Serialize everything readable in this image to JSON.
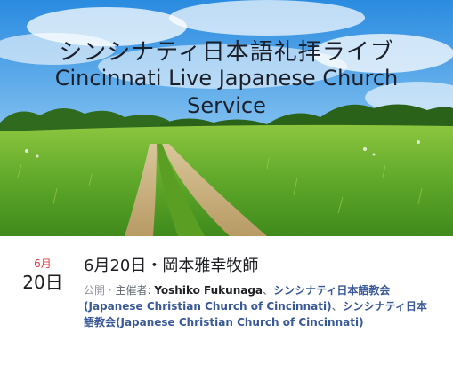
{
  "cover": {
    "title_jp": "シンシナティ日本語礼拝ライブ",
    "title_en_line1": "Cincinnati Live Japanese Church",
    "title_en_line2": "Service"
  },
  "event": {
    "month": "6月",
    "day": "20日",
    "title": "6月20日・岡本雅幸牧師",
    "privacy": "公開",
    "separator": " · ",
    "host_prefix": "主催者: ",
    "host_person": "Yoshiko Fukunaga",
    "comma1": "、",
    "host_org1": "シンシナティ日本語教会(Japanese Christian Church of Cincinnati)",
    "comma2": "、",
    "host_org2": "シンシナティ日本語教会(Japanese Christian Church of Cincinnati)"
  },
  "colors": {
    "month_red": "#e0393e",
    "link_blue": "#385898",
    "text_dark": "#1c1e21",
    "text_grey": "#616770"
  }
}
